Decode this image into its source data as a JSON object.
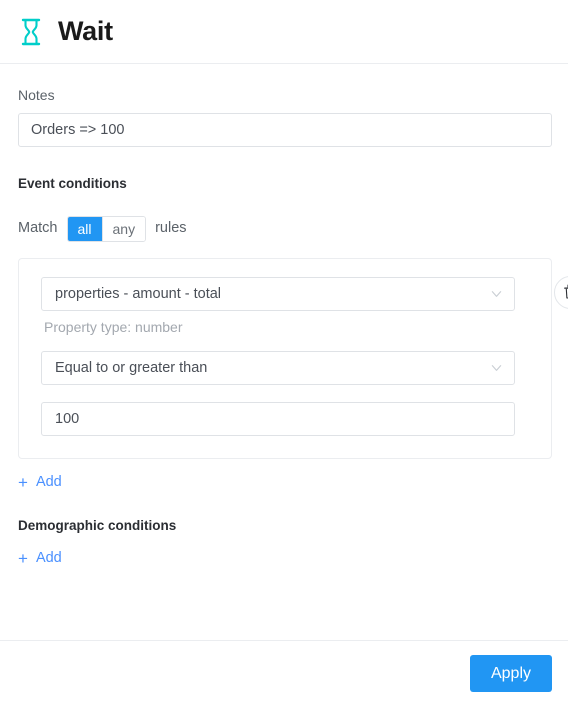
{
  "header": {
    "title": "Wait",
    "icon": "hourglass-icon",
    "icon_color": "#00cec9"
  },
  "notes": {
    "label": "Notes",
    "value": "Orders => 100",
    "placeholder": "Notes"
  },
  "event_conditions": {
    "title": "Event conditions",
    "match": {
      "prefix": "Match",
      "suffix": "rules",
      "options": [
        "all",
        "any"
      ],
      "selected": "all"
    },
    "rules": [
      {
        "property": "properties - amount - total",
        "property_type_label": "Property type: number",
        "operator": "Equal to or greater than",
        "value": "100",
        "delete_icon": "trash-icon"
      }
    ],
    "add_label": "Add",
    "add_icon": "plus-icon"
  },
  "demographic_conditions": {
    "title": "Demographic conditions",
    "add_label": "Add",
    "add_icon": "plus-icon"
  },
  "footer": {
    "apply_label": "Apply"
  },
  "colors": {
    "accent": "#2196f3",
    "link": "#4a90ff",
    "icon_teal": "#00cec9",
    "border": "#dfe2e6"
  }
}
